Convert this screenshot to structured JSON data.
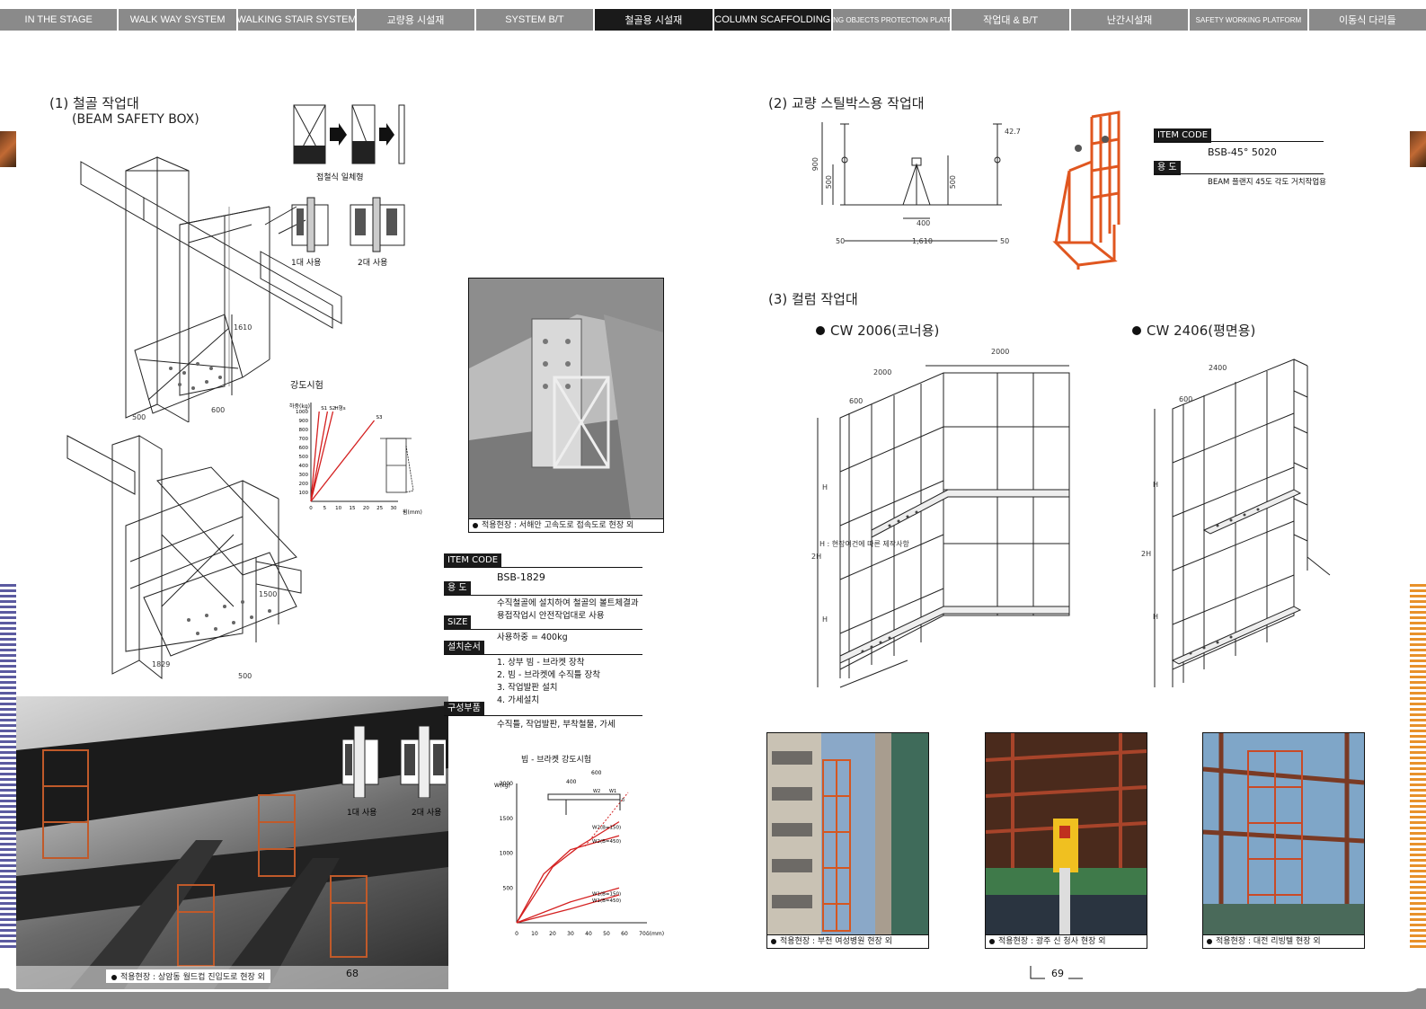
{
  "tabs": [
    {
      "label": "IN THE STAGE",
      "active": false,
      "small": false
    },
    {
      "label": "WALK WAY SYSTEM",
      "active": false,
      "small": false
    },
    {
      "label": "WALKING STAIR SYSTEM",
      "active": false,
      "small": false
    },
    {
      "label": "교량용 시설재",
      "active": false,
      "small": false
    },
    {
      "label": "SYSTEM B/T",
      "active": false,
      "small": false
    },
    {
      "label": "철골용 시설재",
      "active": true,
      "small": false
    },
    {
      "label": "COLUMN SCAFFOLDING",
      "active": true,
      "small": false
    },
    {
      "label": "FALLING OBJECTS PROTECTION PLATFORM",
      "active": false,
      "small": true
    },
    {
      "label": "작업대 & B/T",
      "active": false,
      "small": false
    },
    {
      "label": "난간시설재",
      "active": false,
      "small": false
    },
    {
      "label": "SAFETY WORKING PLATFORM",
      "active": false,
      "small": true
    },
    {
      "label": "이동식 다리들",
      "active": false,
      "small": false
    }
  ],
  "left": {
    "section1_title": "(1) 철골 작업대",
    "section1_subtitle": "(BEAM SAFETY BOX)",
    "fold_caption": "접철식 일체형",
    "use1_caption": "1대 사용",
    "use2_caption": "2대 사용",
    "strength_title": "강도시험",
    "strength_ylabel": "하중(kg)",
    "strength_xlabel": "휨(mm)",
    "strength_yticks": [
      "1000",
      "900",
      "800",
      "700",
      "600",
      "500",
      "400",
      "300",
      "200",
      "100"
    ],
    "strength_xticks": [
      "0",
      "5",
      "10",
      "15",
      "20",
      "25",
      "30"
    ],
    "strength_series": [
      "S1",
      "S2",
      "H형s",
      "S3"
    ],
    "dim_1610": "1610",
    "dim_500a": "500",
    "dim_600": "600",
    "dim_1500": "1500",
    "dim_1829": "1829",
    "dim_500b": "500",
    "photo_caption": "적용현장 : 상암동 월드컵 진입도로 현장 외",
    "photo_use1": "1대 사용",
    "photo_use2": "2대 사용",
    "page_number": "68"
  },
  "middle": {
    "photo_caption": "적용현장 : 서해안 고속도로 접속도로 현장 외",
    "item_code_label": "ITEM CODE",
    "item_code_value": "BSB-1829",
    "use_label": "용 도",
    "use_text_1": "수직철골에 설치하여 철골의 볼트체결과",
    "use_text_2": "용접작업시 안전작업대로 사용",
    "size_label": "SIZE",
    "size_text": "사용하중 = 400kg",
    "install_label": "설치순서",
    "install_steps": [
      "1. 상부 빔 - 브라켓 장착",
      "2. 빔 - 브라켓에 수직틀 장착",
      "3. 작업발판 설치",
      "4. 가세설치"
    ],
    "parts_label": "구성부품",
    "parts_text": "수직틀, 작업발판, 부착철물, 가세",
    "bracket_chart_title": "빔 - 브라켓 강도시험",
    "bracket_ylabel": "W(kg)",
    "bracket_xlabel": "δ(mm)",
    "bracket_yticks": [
      "2000",
      "1500",
      "1000",
      "500"
    ],
    "bracket_xticks": [
      "0",
      "10",
      "20",
      "30",
      "40",
      "50",
      "60",
      "70"
    ],
    "bracket_dims": [
      "600",
      "400",
      "W2",
      "W1",
      "δ"
    ],
    "bracket_series": [
      "W2(B=150)",
      "W2(B=450)",
      "W1(B=150)",
      "W1(B=450)"
    ]
  },
  "right": {
    "section2_title": "(2) 교량 스틸박스용 작업대",
    "item_code_label": "ITEM CODE",
    "item_code_value": "BSB-45° 5020",
    "use_label": "용 도",
    "use_text": "BEAM 플랜지 45도 각도 거치작업용",
    "dims2": [
      "900",
      "500",
      "500",
      "400",
      "1,610",
      "50",
      "50",
      "42.7"
    ],
    "section3_title": "(3) 컬럼 작업대",
    "cw1_title": "CW 2006(코너용)",
    "cw2_title": "CW 2406(평면용)",
    "cw1_dims": [
      "2000",
      "2000",
      "600",
      "H",
      "2H",
      "H"
    ],
    "cw1_note": "H : 현장여건에 따른 제작사항",
    "cw2_dims": [
      "2400",
      "600",
      "H",
      "2H",
      "H"
    ],
    "photo1_caption": "적용현장 : 부천 여성병원 현장 외",
    "photo2_caption": "적용현장 : 광주 신 청사 현장 외",
    "photo3_caption": "적용현장 : 대전 리빙텔 현장 외",
    "page_number": "69"
  },
  "colors": {
    "tab_bg": "#8a8a8a",
    "tab_active": "#1a1a1a",
    "orange_product": "#e0561f",
    "red_curve": "#d42020",
    "side_purple": "#5b5aa0",
    "side_orange": "#e8912a"
  },
  "chart_data": [
    {
      "type": "line",
      "title": "강도시험",
      "xlabel": "휨(mm)",
      "ylabel": "하중(kg)",
      "xlim": [
        0,
        30
      ],
      "ylim": [
        0,
        1000
      ],
      "series": [
        {
          "name": "S1",
          "x": [
            0,
            3
          ],
          "y": [
            0,
            1000
          ]
        },
        {
          "name": "S2",
          "x": [
            0,
            6
          ],
          "y": [
            0,
            1000
          ]
        },
        {
          "name": "H형s",
          "x": [
            0,
            8
          ],
          "y": [
            0,
            1000
          ]
        },
        {
          "name": "S3",
          "x": [
            0,
            23
          ],
          "y": [
            0,
            900
          ]
        }
      ]
    },
    {
      "type": "line",
      "title": "빔 - 브라켓 강도시험",
      "xlabel": "δ(mm)",
      "ylabel": "W(kg)",
      "xlim": [
        0,
        70
      ],
      "ylim": [
        0,
        2000
      ],
      "series": [
        {
          "name": "W2(B=150)",
          "x": [
            0,
            20,
            35,
            57
          ],
          "y": [
            0,
            800,
            1100,
            1450
          ]
        },
        {
          "name": "W2(B=450)",
          "x": [
            0,
            15,
            30,
            57
          ],
          "y": [
            0,
            700,
            1050,
            1250
          ]
        },
        {
          "name": "W1(B=150)",
          "x": [
            0,
            30,
            57
          ],
          "y": [
            0,
            300,
            500
          ]
        },
        {
          "name": "W1(B=450)",
          "x": [
            0,
            30,
            57
          ],
          "y": [
            0,
            200,
            400
          ]
        }
      ]
    }
  ]
}
